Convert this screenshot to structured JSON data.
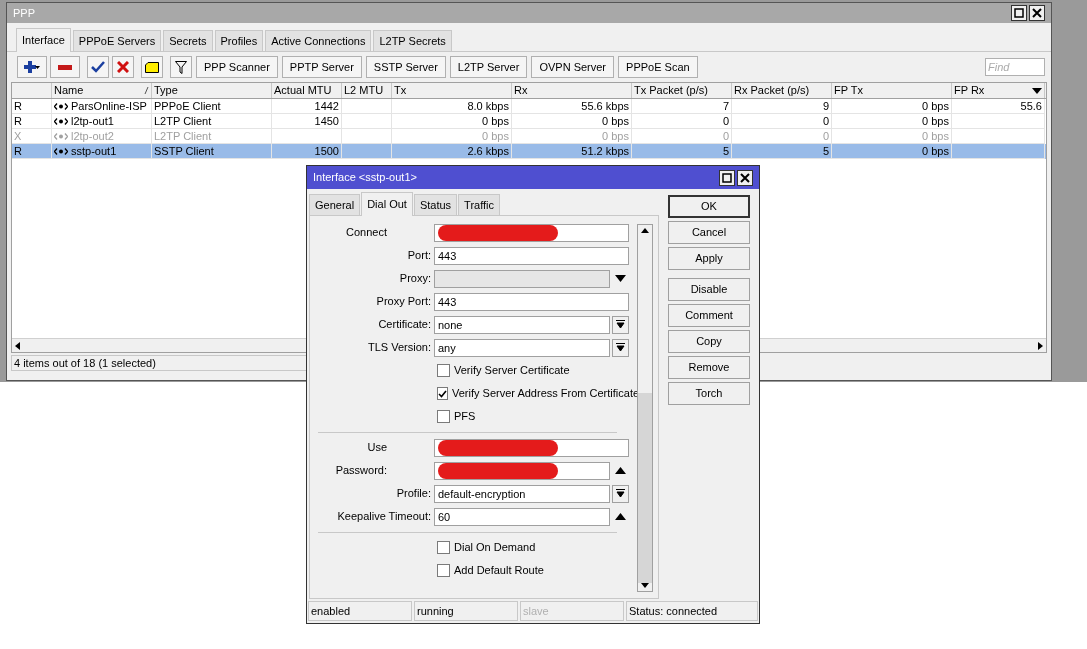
{
  "ppp_window": {
    "title": "PPP",
    "tabs": [
      {
        "label": "Interface",
        "selected": true
      },
      {
        "label": "PPPoE Servers",
        "selected": false
      },
      {
        "label": "Secrets",
        "selected": false
      },
      {
        "label": "Profiles",
        "selected": false
      },
      {
        "label": "Active Connections",
        "selected": false
      },
      {
        "label": "L2TP Secrets",
        "selected": false
      }
    ],
    "toolbar_buttons": [
      "PPP Scanner",
      "PPTP Server",
      "SSTP Server",
      "L2TP Server",
      "OVPN Server",
      "PPPoE Scan"
    ],
    "search": {
      "placeholder": "Find"
    },
    "table": {
      "columns": [
        {
          "sorted": false
        },
        {
          "label": "Name",
          "sorted": true
        },
        {
          "label": "Type",
          "sorted": false
        },
        {
          "label": "Actual MTU",
          "sorted": false
        },
        {
          "label": "L2 MTU",
          "sorted": false
        },
        {
          "label": "Tx",
          "sorted": false
        },
        {
          "label": "Rx",
          "sorted": false
        },
        {
          "label": "Tx Packet (p/s)",
          "sorted": false
        },
        {
          "label": "Rx Packet (p/s)",
          "sorted": false
        },
        {
          "label": "FP Tx",
          "sorted": false
        },
        {
          "label": "FP Rx",
          "sorted": false
        }
      ],
      "rows": [
        {
          "cells": [
            "R",
            "ParsOnline-ISP",
            "PPPoE Client",
            "1442",
            null,
            "8.0 kbps",
            "55.6 kbps",
            "7",
            "9",
            "0 bps",
            "55.6"
          ],
          "disabled": false,
          "selected": false
        },
        {
          "cells": [
            "R",
            "l2tp-out1",
            "L2TP Client",
            "1450",
            null,
            "0 bps",
            "0 bps",
            "0",
            "0",
            "0 bps",
            null
          ],
          "disabled": false,
          "selected": false
        },
        {
          "cells": [
            "X",
            "l2tp-out2",
            "L2TP Client",
            null,
            null,
            "0 bps",
            "0 bps",
            "0",
            "0",
            "0 bps",
            null
          ],
          "disabled": true,
          "selected": false
        },
        {
          "cells": [
            "R",
            "sstp-out1",
            "SSTP Client",
            "1500",
            null,
            "2.6 kbps",
            "51.2 kbps",
            "5",
            "5",
            "0 bps",
            null
          ],
          "disabled": false,
          "selected": true
        }
      ]
    },
    "status_bar": "4 items out of 18 (1 selected)"
  },
  "dialog": {
    "title": "Interface <sstp-out1>",
    "tabs": [
      {
        "label": "General",
        "selected": false
      },
      {
        "label": "Dial Out",
        "selected": true
      },
      {
        "label": "Status",
        "selected": false
      },
      {
        "label": "Traffic",
        "selected": false
      }
    ],
    "fields": [
      {
        "kind": "text",
        "label": "Connect",
        "redacted": true
      },
      {
        "kind": "text",
        "label": "Port:",
        "value": "443"
      },
      {
        "kind": "proxy",
        "label": "Proxy:"
      },
      {
        "kind": "text",
        "label": "Proxy Port:",
        "value": "443"
      },
      {
        "kind": "select",
        "label": "Certificate:",
        "value": "none"
      },
      {
        "kind": "select",
        "label": "TLS Version:",
        "value": "any"
      },
      {
        "kind": "checkbox",
        "label": "Verify Server Certificate",
        "checked": false
      },
      {
        "kind": "checkbox",
        "label": "Verify Server Address From Certificate",
        "checked": true
      },
      {
        "kind": "checkbox",
        "label": "PFS",
        "checked": false
      },
      {
        "kind": "separator"
      },
      {
        "kind": "text",
        "label": "Use",
        "redacted": true
      },
      {
        "kind": "expand",
        "label": "Password:",
        "redacted": true
      },
      {
        "kind": "select",
        "label": "Profile:",
        "value": "default-encryption"
      },
      {
        "kind": "expand",
        "label": "Keepalive Timeout:",
        "value": "60"
      },
      {
        "kind": "separator"
      },
      {
        "kind": "checkbox",
        "label": "Dial On Demand",
        "checked": false
      },
      {
        "kind": "checkbox",
        "label": "Add Default Route",
        "checked": false
      }
    ],
    "buttons": [
      {
        "label": "OK",
        "default": true
      },
      {
        "label": "Cancel",
        "default": false
      },
      {
        "label": "Apply",
        "default": false
      },
      {
        "label": "Disable",
        "default": false
      },
      {
        "label": "Comment",
        "default": false
      },
      {
        "label": "Copy",
        "default": false
      },
      {
        "label": "Remove",
        "default": false
      },
      {
        "label": "Torch",
        "default": false
      }
    ],
    "status_bar": [
      {
        "text": "enabled",
        "disabled": false
      },
      {
        "text": "running",
        "disabled": false
      },
      {
        "text": "slave",
        "disabled": true
      },
      {
        "text": "Status: connected",
        "disabled": false
      }
    ]
  }
}
